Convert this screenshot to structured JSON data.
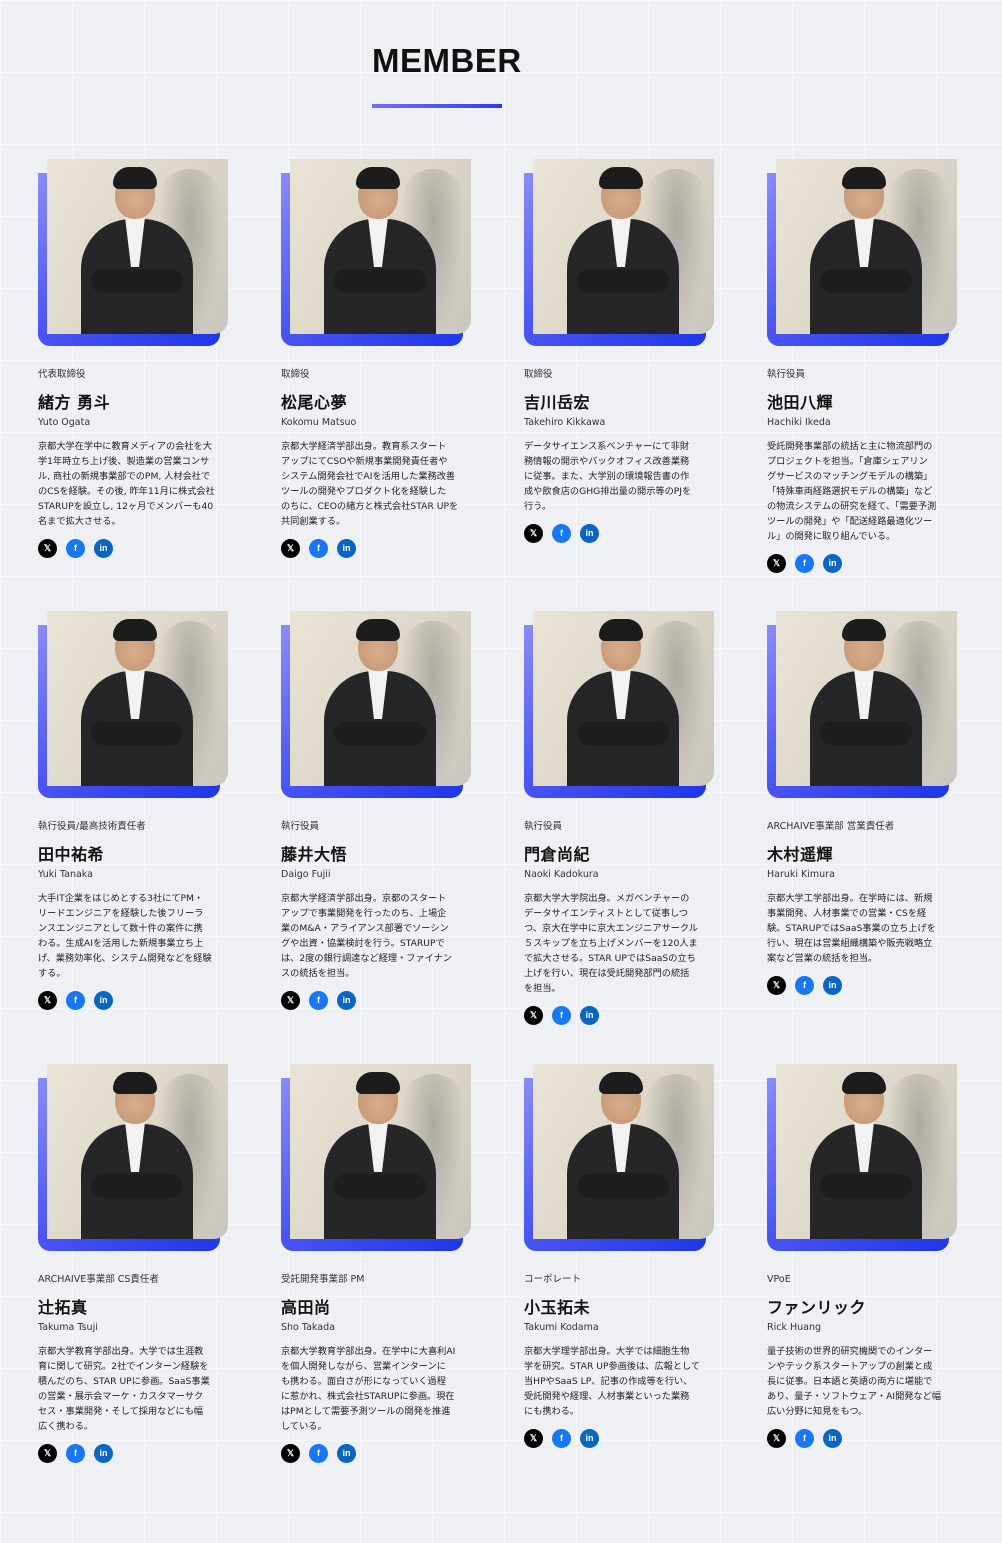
{
  "section": {
    "title": "MEMBER"
  },
  "members": [
    {
      "role": "代表取締役",
      "name": "緒方 勇斗",
      "name_en": "Yuto Ogata",
      "bio": "京都大学在学中に教育メディアの会社を大\n学1年時立ち上げ後、製造業の営業コンサ\nル, 商社の新規事業部でのPM, 人材会社で\nのCSを経験。その後, 昨年11月に株式会社\nSTARUPを設立し, 12ヶ月でメンバーも40\n名まで拡大させる。"
    },
    {
      "role": "取締役",
      "name": "松尾心夢",
      "name_en": "Kokomu Matsuo",
      "bio": "京都大学経済学部出身。教育系スタート\nアップにてCSOや新規事業開発責任者や\nシステム開発会社でAIを活用した業務改善\nツールの開発やプロダクト化を経験した\nのちに、CEOの緒方と株式会社STAR UPを\n共同創業する。"
    },
    {
      "role": "取締役",
      "name": "吉川岳宏",
      "name_en": "Takehiro Kikkawa",
      "bio": "データサイエンス系ベンチャーにて非財\n務情報の開示やバックオフィス改善業務\nに従事。また、大学別の環境報告書の作\n成や飲食店のGHG排出量の開示等のPJを\n行う。"
    },
    {
      "role": "執行役員",
      "name": "池田八輝",
      "name_en": "Hachiki Ikeda",
      "bio": "受託開発事業部の統括と主に物流部門の\nプロジェクトを担当。「倉庫シェアリン\nグサービスのマッチングモデルの構築」\n「特殊車両経路選択モデルの構築」など\nの物流システムの研究を経て、「需要予測\nツールの開発」や「配送経路最適化ツー\nル」の開発に取り組んでいる。"
    },
    {
      "role": "執行役員/最高技術責任者",
      "name": "田中祐希",
      "name_en": "Yuki Tanaka",
      "bio": "大手IT企業をはじめとする3社にてPM・\nリードエンジニアを経験した後フリーラ\nンスエンジニアとして数十件の案件に携\nわる。生成AIを活用した新規事業立ち上\nげ、業務効率化、システム開発などを経験\nする。"
    },
    {
      "role": "執行役員",
      "name": "藤井大悟",
      "name_en": "Daigo Fujii",
      "bio": "京都大学経済学部出身。京都のスタート\nアップで事業開発を行ったのち、上場企\n業のM&A・アライアンス部署でソーシン\nグや出資・協業検討を行う。STARUPで\nは、2度の銀行調達など経理・ファイナン\nスの統括を担当。"
    },
    {
      "role": "執行役員",
      "name": "門倉尚紀",
      "name_en": "Naoki Kadokura",
      "bio": "京都大学大学院出身。メガベンチャーの\nデータサイエンティストとして従事しつ\nつ、京大在学中に京大エンジニアサークル\n５スキップを立ち上げメンバーを120人ま\nで拡大させる。STAR UPではSaaSの立ち\n上げを行い、現在は受託開発部門の統括\nを担当。"
    },
    {
      "role": "ARCHAIVE事業部 営業責任者",
      "name": "木村遥輝",
      "name_en": "Haruki Kimura",
      "bio": "京都大学工学部出身。在学時には、新規\n事業開発、人材事業での営業・CSを経\n験。STARUPではSaaS事業の立ち上げを\n行い、現在は営業組織構築や販売戦略立\n案など営業の統括を担当。"
    },
    {
      "role": "ARCHAIVE事業部 CS責任者",
      "name": "辻拓真",
      "name_en": "Takuma Tsuji",
      "bio": "京都大学教育学部出身。大学では生涯教\n育に関して研究。2社でインターン経験を\n積んだのち、STAR UPに参画。SaaS事業\nの営業・展示会マーケ・カスタマーサク\nセス・事業開発・そして採用などにも幅\n広く携わる。"
    },
    {
      "role": "受託開発事業部 PM",
      "name": "高田尚",
      "name_en": "Sho Takada",
      "bio": "京都大学教育学部出身。在学中に大喜利AI\nを個人開発しながら、営業インターンに\nも携わる。面白さが形になっていく過程\nに惹かれ、株式会社STARUPに参画。現在\nはPMとして需要予測ツールの開発を推進\nしている。"
    },
    {
      "role": "コーポレート",
      "name": "小玉拓未",
      "name_en": "Takumi Kodama",
      "bio": "京都大学理学部出身。大学では細胞生物\n学を研究。STAR UP参画後は、広報として\n当HPやSaaS LP、記事の作成等を行い、\n受託開発や経理、人材事業といった業務\nにも携わる。"
    },
    {
      "role": "VPoE",
      "name": "ファンリック",
      "name_en": "Rick Huang",
      "bio": "量子技術の世界的研究機関でのインター\nンやテック系スタートアップの創業と成\n長に従事。日本語と英語の両方に堪能で\nあり、量子・ソフトウェア・AI開発など幅\n広い分野に知見をもつ。"
    }
  ],
  "social": {
    "x": "𝕏",
    "facebook": "f",
    "linkedin": "in"
  },
  "colors": {
    "accent_start": "#7b6df6",
    "accent_end": "#1e36e8",
    "facebook": "#1877f2",
    "linkedin": "#0a66c2"
  },
  "icons": {
    "x": "x-icon",
    "facebook": "facebook-icon",
    "linkedin": "linkedin-icon"
  }
}
